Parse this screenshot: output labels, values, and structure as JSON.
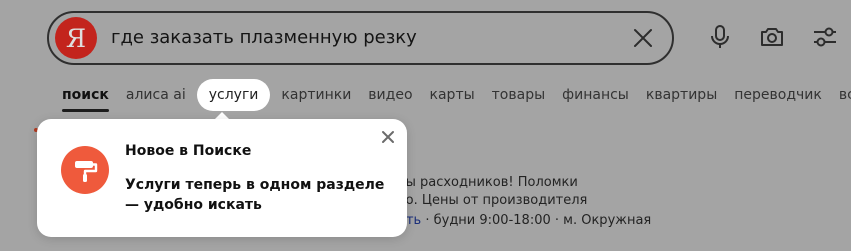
{
  "search": {
    "logo_letter": "Я",
    "query": "где заказать плазменную резку"
  },
  "icons": {
    "clear": "close-icon",
    "voice": "microphone-icon",
    "camera": "camera-search-icon",
    "filters": "filter-sliders-icon",
    "popup_icon": "paint-roller-icon"
  },
  "tabs": [
    {
      "label": "поиск"
    },
    {
      "label": "алиса ai"
    },
    {
      "label": "услуги"
    },
    {
      "label": "картинки"
    },
    {
      "label": "видео"
    },
    {
      "label": "карты"
    },
    {
      "label": "товары"
    },
    {
      "label": "финансы"
    },
    {
      "label": "квартиры"
    },
    {
      "label": "переводчик"
    },
    {
      "label": "все"
    }
  ],
  "results": {
    "line1": "ты расходников! Поломки",
    "line2": "во. Цены от производителя",
    "line3_link": "ать",
    "line3_hours": "· будни 9:00-18:00",
    "line3_address": "· м. Окружная"
  },
  "popup": {
    "title": "Новое в Поиске",
    "text": "Услуги теперь в одном разделе — удобно искать"
  },
  "colors": {
    "brand_red": "#c3241d",
    "popup_icon_bg": "#ef5a3c",
    "overlay": "#a4a4a4"
  }
}
